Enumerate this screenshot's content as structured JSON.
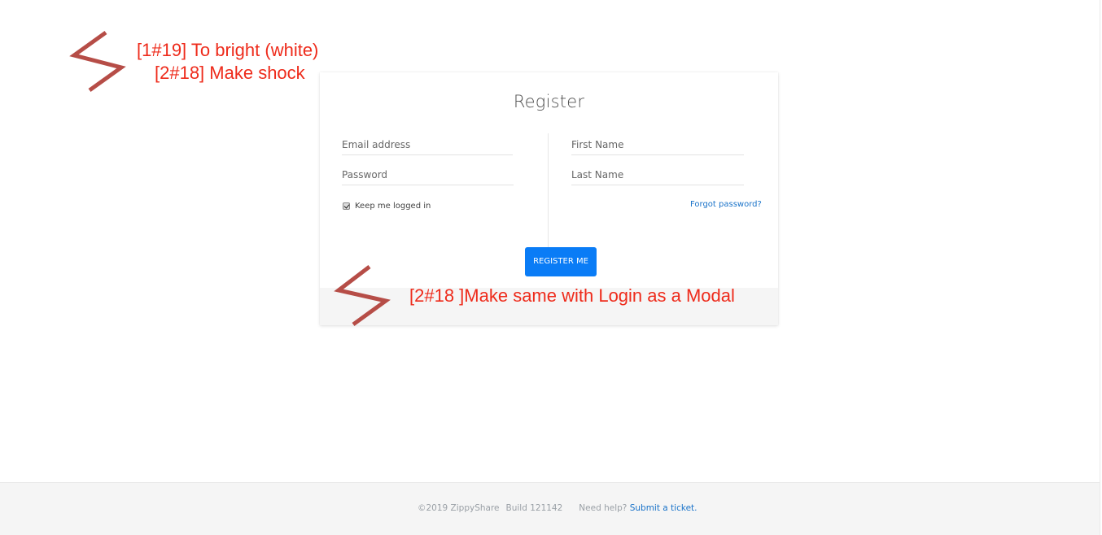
{
  "register": {
    "title": "Register",
    "email_placeholder": "Email address",
    "password_placeholder": "Password",
    "first_name_placeholder": "First Name",
    "last_name_placeholder": "Last Name",
    "keep_logged_in_label": "Keep me logged in",
    "keep_logged_in_checked": true,
    "forgot_password_label": "Forgot password?",
    "submit_label": "REGISTER ME"
  },
  "annotations": {
    "note1": "[1#19] To bright (white)",
    "note2": "[2#18] Make shock",
    "note3": "[2#18 ]Make same with Login as a Modal",
    "color": "#ee2b1b",
    "scribble_color": "#b64d47"
  },
  "footer": {
    "copyright": "©2019 ZippyShare",
    "build": "Build 121142",
    "help_text": "Need help?",
    "help_link": "Submit a ticket",
    "help_suffix": "."
  },
  "colors": {
    "primary_button": "#0a7cf6",
    "link": "#1a73c9"
  }
}
